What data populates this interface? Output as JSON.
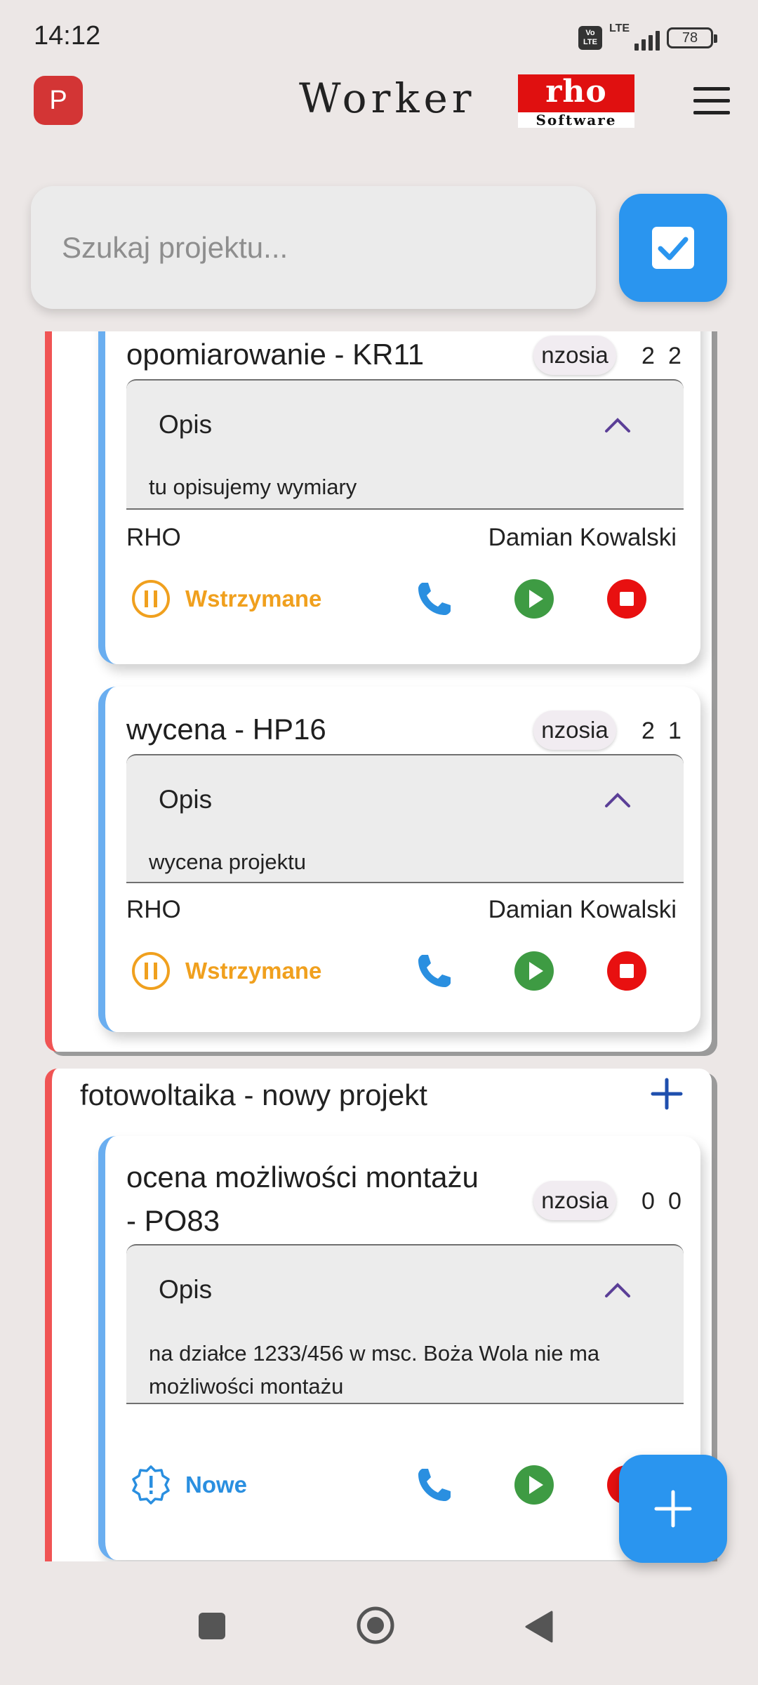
{
  "status_bar": {
    "time": "14:12",
    "volte": "Vo LTE",
    "network": "LTE",
    "battery": "78"
  },
  "app_bar": {
    "avatar_letter": "P",
    "title": "Worker",
    "logo_top": "rho",
    "logo_bottom": "Software"
  },
  "search": {
    "placeholder": "Szukaj projektu..."
  },
  "projects": [
    {
      "title": "",
      "tasks": [
        {
          "title": "opomiarowanie - KR11",
          "user": "nzosia",
          "count_a": "2",
          "count_b": "2",
          "desc_label": "Opis",
          "description": "tu opisujemy wymiary",
          "company": "RHO",
          "person": "Damian Kowalski",
          "status": "Wstrzymane",
          "status_color": "#f0a01e"
        },
        {
          "title": "wycena  - HP16",
          "user": "nzosia",
          "count_a": "2",
          "count_b": "1",
          "desc_label": "Opis",
          "description": "wycena projektu",
          "company": "RHO",
          "person": "Damian Kowalski",
          "status": "Wstrzymane",
          "status_color": "#f0a01e"
        }
      ]
    },
    {
      "title": "fotowoltaika - nowy projekt",
      "tasks": [
        {
          "title": "ocena możliwości montażu - PO83",
          "title_line1": "ocena możliwości montażu",
          "title_line2": "- PO83",
          "user": "nzosia",
          "count_a": "0",
          "count_b": "0",
          "desc_label": "Opis",
          "description": "na działce 1233/456 w msc. Boża Wola nie ma możliwości montażu",
          "description_line1": "na działce 1233/456 w msc. Boża Wola nie ma",
          "description_line2": "możliwości montażu",
          "status": "Nowe",
          "status_color": "#2a8fe0"
        }
      ]
    }
  ],
  "colors": {
    "accent": "#2a95ef",
    "project_border": "#f05454",
    "task_border": "#6aaef0",
    "play": "#3e9b43",
    "stop": "#e81010",
    "phone": "#2a8fe0",
    "paused": "#f0a01e"
  }
}
